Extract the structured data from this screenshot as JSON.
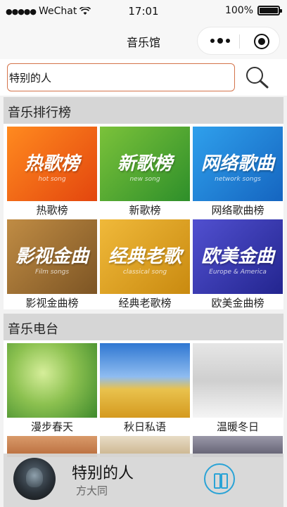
{
  "status_bar": {
    "carrier": "WeChat",
    "time": "17:01",
    "battery": "100%"
  },
  "navbar": {
    "title": "音乐馆"
  },
  "search": {
    "value": "特别的人",
    "icon": "search-icon"
  },
  "sections": {
    "charts": "音乐排行榜",
    "radio": "音乐电台"
  },
  "charts": [
    {
      "label": "热歌榜",
      "art_text": "热歌榜",
      "art_sub": "hot song",
      "color": "#f1691b"
    },
    {
      "label": "新歌榜",
      "art_text": "新歌榜",
      "art_sub": "new song",
      "color": "#4aa72e"
    },
    {
      "label": "网络歌曲榜",
      "art_text": "网络歌曲",
      "art_sub": "network songs",
      "color": "#1e7fd0"
    },
    {
      "label": "影视金曲榜",
      "art_text": "影视金曲",
      "art_sub": "Film songs",
      "color": "#a8772f"
    },
    {
      "label": "经典老歌榜",
      "art_text": "经典老歌",
      "art_sub": "classical song",
      "color": "#d9a21b"
    },
    {
      "label": "欧美金曲榜",
      "art_text": "欧美金曲",
      "art_sub": "Europe & America",
      "color": "#3b3fb5"
    }
  ],
  "radio": [
    {
      "label": "漫步春天",
      "color": "#7ab34a"
    },
    {
      "label": "秋日私语",
      "color": "#4f8fd6"
    },
    {
      "label": "温暖冬日",
      "color": "#dcdcdc"
    }
  ],
  "player": {
    "song": "特别的人",
    "artist": "方大同",
    "accent": "#2aa3d6"
  }
}
